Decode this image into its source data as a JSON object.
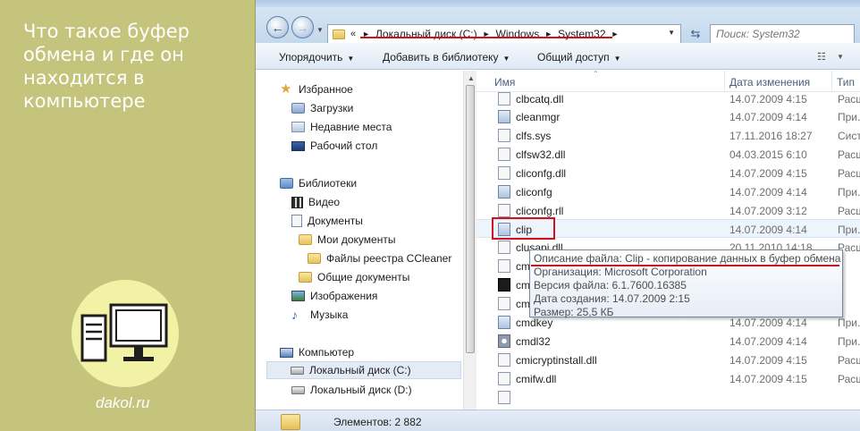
{
  "article": {
    "title": "Что такое буфер обмена и где он находится в компьютере",
    "site": "dakol.ru",
    "panel_color": "#c4c47c"
  },
  "address_bar": {
    "overflow": "«",
    "crumbs": [
      "Локальный диск (C:)",
      "Windows",
      "System32"
    ],
    "search_placeholder": "Поиск: System32"
  },
  "toolbar": {
    "organize": "Упорядочить",
    "add_to_library": "Добавить в библиотеку",
    "share": "Общий доступ"
  },
  "navigation": {
    "favorites": "Избранное",
    "downloads": "Загрузки",
    "recent_places": "Недавние места",
    "desktop": "Рабочий стол",
    "libraries": "Библиотеки",
    "video": "Видео",
    "documents": "Документы",
    "my_documents": "Мои документы",
    "ccleaner_files": "Файлы реестра CCleaner",
    "public_documents": "Общие документы",
    "images": "Изображения",
    "music": "Музыка",
    "computer": "Компьютер",
    "disk_c": "Локальный диск (C:)",
    "disk_d": "Локальный диск (D:)"
  },
  "file_list": {
    "columns": {
      "name": "Имя",
      "date": "Дата изменения",
      "type": "Тип"
    },
    "rows": [
      {
        "name": "clbcatq.dll",
        "date": "14.07.2009 4:15",
        "type": "Расш",
        "icon": "dll-icon"
      },
      {
        "name": "cleanmgr",
        "date": "14.07.2009 4:14",
        "type": "При.",
        "icon": "exe-icon"
      },
      {
        "name": "clfs.sys",
        "date": "17.11.2016 18:27",
        "type": "Сист",
        "icon": "sys-icon"
      },
      {
        "name": "clfsw32.dll",
        "date": "04.03.2015 6:10",
        "type": "Расш",
        "icon": "dll-icon"
      },
      {
        "name": "cliconfg.dll",
        "date": "14.07.2009 4:15",
        "type": "Расш",
        "icon": "dll-icon"
      },
      {
        "name": "cliconfg",
        "date": "14.07.2009 4:14",
        "type": "При.",
        "icon": "exe-icon"
      },
      {
        "name": "cliconfg.rll",
        "date": "14.07.2009 3:12",
        "type": "Расш",
        "icon": "dll-icon"
      },
      {
        "name": "clip",
        "date": "14.07.2009 4:14",
        "type": "При.",
        "icon": "exe-icon"
      },
      {
        "name": "clusapi.dll",
        "date": "20.11.2010 14:18",
        "type": "Расш",
        "icon": "dll-icon"
      },
      {
        "name": "cm",
        "date": "",
        "type": "",
        "icon": "dll-icon"
      },
      {
        "name": "cm",
        "date": "",
        "type": "",
        "icon": "cmd-icon"
      },
      {
        "name": "cm",
        "date": "",
        "type": "",
        "icon": "dll-icon"
      },
      {
        "name": "cmdkey",
        "date": "14.07.2009 4:14",
        "type": "При.",
        "icon": "exe-icon"
      },
      {
        "name": "cmdl32",
        "date": "14.07.2009 4:14",
        "type": "При.",
        "icon": "gear-icon"
      },
      {
        "name": "cmicryptinstall.dll",
        "date": "14.07.2009 4:15",
        "type": "Расш",
        "icon": "dll-icon"
      },
      {
        "name": "cmifw.dll",
        "date": "14.07.2009 4:15",
        "type": "Расш",
        "icon": "dll-icon"
      },
      {
        "name": "",
        "date": "",
        "type": "",
        "icon": "dll-icon"
      }
    ]
  },
  "tooltip": {
    "description": "Описание файла: Clip - копирование данных в буфер обмена",
    "organization": "Организация: Microsoft Corporation",
    "version": "Версия файла: 6.1.7600.16385",
    "created": "Дата создания: 14.07.2009 2:15",
    "size": "Размер: 25,5 КБ"
  },
  "status_bar": {
    "items_count": "Элементов: 2 882"
  },
  "colors": {
    "annotation_red": "#c8141e",
    "window_chrome": "#c4d8ec"
  }
}
